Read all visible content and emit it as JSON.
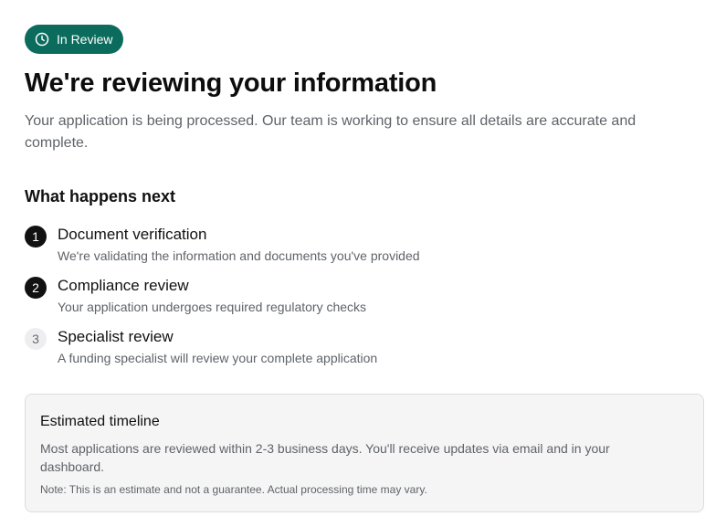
{
  "status": {
    "label": "In Review",
    "icon": "clock-icon",
    "color": "#0b6b5d"
  },
  "header": {
    "title": "We're reviewing your information",
    "subtitle": "Your application is being processed. Our team is working to ensure all details are accurate and complete."
  },
  "next_steps": {
    "heading": "What happens next",
    "items": [
      {
        "number": "1",
        "title": "Document verification",
        "description": "We're validating the information and documents you've provided",
        "state": "active"
      },
      {
        "number": "2",
        "title": "Compliance review",
        "description": "Your application undergoes required regulatory checks",
        "state": "active"
      },
      {
        "number": "3",
        "title": "Specialist review",
        "description": "A funding specialist will review your complete application",
        "state": "pending"
      }
    ]
  },
  "timeline": {
    "title": "Estimated timeline",
    "body": "Most applications are reviewed within 2-3 business days. You'll receive updates via email and in your dashboard.",
    "note": "Note: This is an estimate and not a guarantee. Actual processing time may vary."
  }
}
